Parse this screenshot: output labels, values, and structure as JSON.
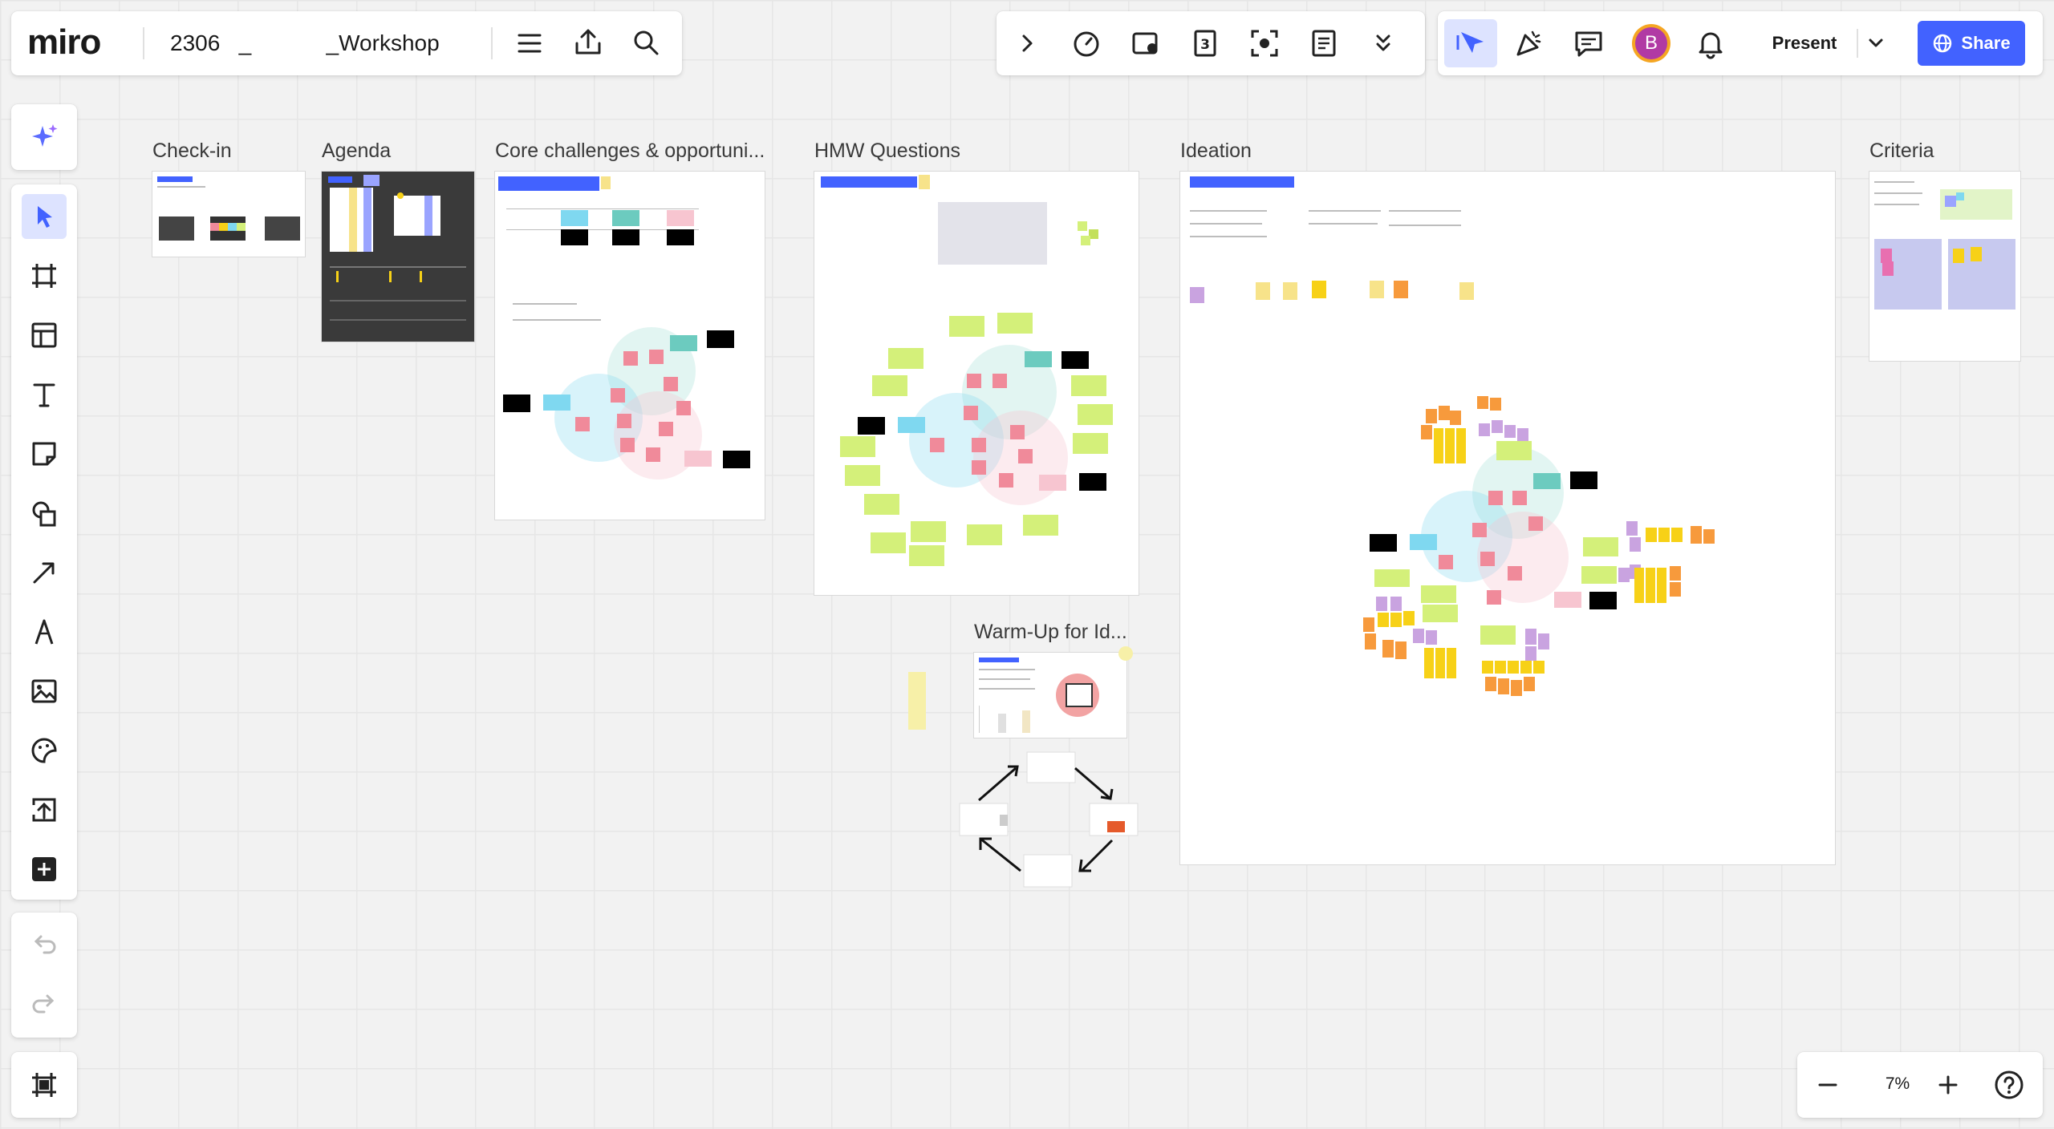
{
  "header": {
    "logo": "miro",
    "board_title": "2306   _            _Workshop"
  },
  "toolbar_right": {
    "present_label": "Present",
    "share_label": "Share",
    "avatar_initial": "B"
  },
  "frames": [
    {
      "title": "Check-in"
    },
    {
      "title": "Agenda"
    },
    {
      "title": "Core challenges & opportuni..."
    },
    {
      "title": "HMW Questions"
    },
    {
      "title": "Ideation"
    },
    {
      "title": "Criteria"
    },
    {
      "title": "Warm-Up for Id..."
    }
  ],
  "zoom": {
    "level": "7%"
  },
  "colors": {
    "accent": "#4262ff",
    "sticky_pink": "#f08a9a",
    "sticky_green": "#d4f07a",
    "sticky_yellow": "#f7d117",
    "sticky_orange": "#f79a3c",
    "sticky_purple": "#c9a3e0",
    "sticky_cyan": "#7fd8f0",
    "sticky_teal": "#6ccbbf"
  }
}
